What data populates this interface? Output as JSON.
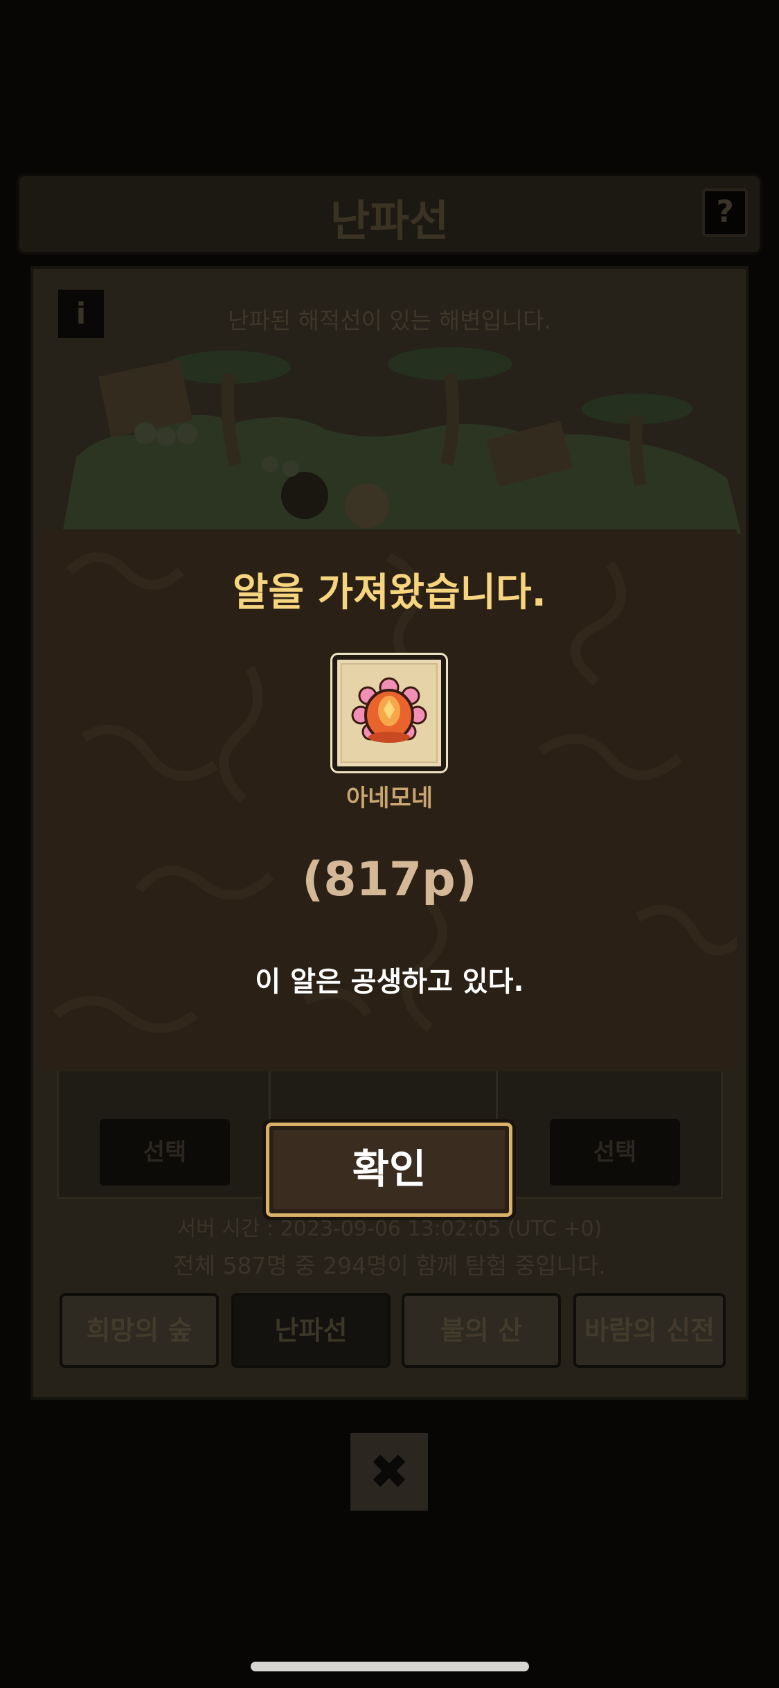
{
  "header": {
    "title": "난파선",
    "help_label": "?"
  },
  "location": {
    "info_label": "i",
    "description": "난파된 해적선이 있는 해변입니다."
  },
  "cards": {
    "select_label": "선택"
  },
  "status": {
    "server_time": "서버 시간 : 2023-09-06 13:02:05 (UTC +0)",
    "participants": "전체 587명 중 294명이 함께 탐험 중입니다."
  },
  "tabs": [
    {
      "label": "희망의 숲"
    },
    {
      "label": "난파선"
    },
    {
      "label": "불의 산"
    },
    {
      "label": "바람의 신전"
    }
  ],
  "close_label": "✖",
  "modal": {
    "title": "알을 가져왔습니다.",
    "egg_name": "아네모네",
    "points": "(817p)",
    "description": "이 알은 공생하고 있다.",
    "confirm_label": "확인"
  },
  "colors": {
    "modal_bg": "#2a2016",
    "title_accent": "#f6d57e",
    "egg_name": "#c9a671",
    "points": "#d4b898",
    "button_border": "#d9b26a"
  }
}
